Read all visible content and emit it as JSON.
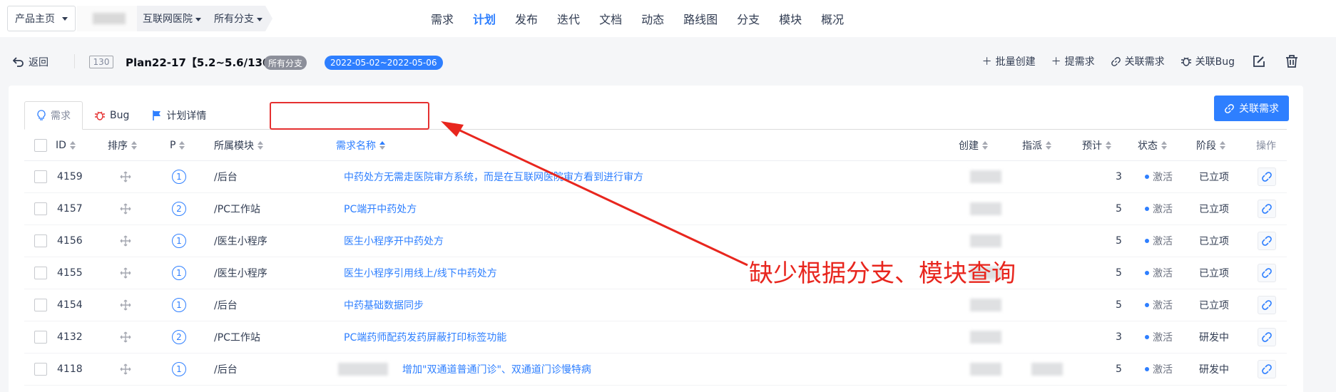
{
  "topnav": {
    "product_btn": "产品主页",
    "crumbs": [
      "互联网医院",
      "所有分支"
    ],
    "menu": [
      "需求",
      "计划",
      "发布",
      "迭代",
      "文档",
      "动态",
      "路线图",
      "分支",
      "模块",
      "概况"
    ],
    "active_menu": "计划"
  },
  "planbar": {
    "back": "返回",
    "id": "130",
    "title": "Plan22-17【5.2~5.6/130】",
    "branch_badge": "所有分支",
    "date_badge": "2022-05-02~2022-05-06",
    "actions": [
      "批量创建",
      "提需求",
      "关联需求",
      "关联Bug"
    ]
  },
  "tabs": [
    "需求",
    "Bug",
    "计划详情"
  ],
  "link_button": "关联需求",
  "annotation": "缺少根据分支、模块查询",
  "table": {
    "headers": [
      "ID",
      "排序",
      "P",
      "所属模块",
      "需求名称",
      "创建",
      "指派",
      "预计",
      "状态",
      "阶段",
      "操作"
    ],
    "rows": [
      {
        "id": "4159",
        "pri": "1",
        "module": "/后台",
        "name": "中药处方无需走医院审方系统，而是在互联网医院审方看到进行审方",
        "estimate": "3",
        "status": "激活",
        "stage": "已立项"
      },
      {
        "id": "4157",
        "pri": "2",
        "module": "/PC工作站",
        "name": "PC端开中药处方",
        "estimate": "5",
        "status": "激活",
        "stage": "已立项"
      },
      {
        "id": "4156",
        "pri": "1",
        "module": "/医生小程序",
        "name": "医生小程序开中药处方",
        "estimate": "5",
        "status": "激活",
        "stage": "已立项"
      },
      {
        "id": "4155",
        "pri": "1",
        "module": "/医生小程序",
        "name": "医生小程序引用线上/线下中药处方",
        "estimate": "5",
        "status": "激活",
        "stage": "已立项"
      },
      {
        "id": "4154",
        "pri": "1",
        "module": "/后台",
        "name": "中药基础数据同步",
        "estimate": "5",
        "status": "激活",
        "stage": "已立项"
      },
      {
        "id": "4132",
        "pri": "2",
        "module": "/PC工作站",
        "name": "PC端药师配药发药屏蔽打印标签功能",
        "estimate": "3",
        "status": "激活",
        "stage": "研发中"
      },
      {
        "id": "4118",
        "pri": "1",
        "module": "/后台",
        "name": "增加\"双通道普通门诊\"、双通道门诊慢特病",
        "estimate": "5",
        "status": "激活",
        "stage": "研发中"
      }
    ]
  },
  "colors": {
    "accent": "#2e7fff",
    "annotation": "#e8261e"
  }
}
